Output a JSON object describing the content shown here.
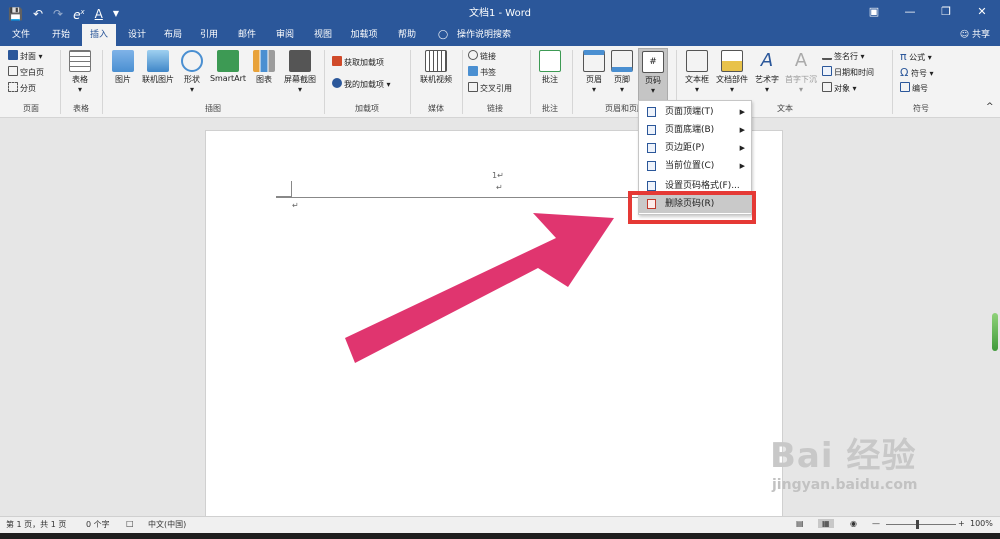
{
  "title_bar": {
    "document_title": "文档1 - Word",
    "qat_icons": [
      "save-icon",
      "undo-icon",
      "redo-icon",
      "equation-icon",
      "font-color-icon",
      "customize-qat-icon"
    ],
    "window_buttons": [
      "ribbon-display-icon",
      "minimize-icon",
      "restore-icon",
      "close-icon"
    ]
  },
  "tabs": [
    "文件",
    "开始",
    "插入",
    "设计",
    "布局",
    "引用",
    "邮件",
    "审阅",
    "视图",
    "加载项",
    "帮助"
  ],
  "active_tab": "插入",
  "tell_me": "操作说明搜索",
  "share": "共享",
  "ribbon": {
    "pages": {
      "cover": "封面",
      "blank": "空白页",
      "break": "分页",
      "label": "页面"
    },
    "tables": {
      "table": "表格",
      "label": "表格"
    },
    "illustrations": {
      "picture": "图片",
      "online_picture": "联机图片",
      "shapes": "形状",
      "smartart": "SmartArt",
      "chart": "图表",
      "screenshot": "屏幕截图",
      "label": "插图"
    },
    "addins": {
      "get": "获取加载项",
      "mine": "我的加载项",
      "label": "加载项"
    },
    "media": {
      "online_video": "联机视频",
      "label": "媒体"
    },
    "links": {
      "link": "链接",
      "bookmark": "书签",
      "cross_ref": "交叉引用",
      "label": "链接"
    },
    "comments": {
      "comment": "批注",
      "label": "批注"
    },
    "header_footer": {
      "header": "页眉",
      "footer": "页脚",
      "page_number": "页码",
      "label": "页眉和页脚"
    },
    "text": {
      "textbox": "文本框",
      "quick_parts": "文档部件",
      "wordart": "艺术字",
      "dropcap": "首字下沉",
      "signature": "签名行",
      "datetime": "日期和时间",
      "object": "对象",
      "label": "文本"
    },
    "symbols": {
      "equation": "公式",
      "symbol": "符号",
      "number": "编号",
      "label": "符号"
    }
  },
  "page_number_menu": [
    {
      "label": "页面顶端(T)",
      "submenu": true
    },
    {
      "label": "页面底端(B)",
      "submenu": true
    },
    {
      "label": "页边距(P)",
      "submenu": true
    },
    {
      "label": "当前位置(C)",
      "submenu": true
    },
    {
      "label": "设置页码格式(F)...",
      "submenu": false
    },
    {
      "label": "删除页码(R)",
      "submenu": false
    }
  ],
  "document": {
    "header_page_number": "1↵",
    "para_mark": "↵"
  },
  "status_bar": {
    "pages": "第 1 页，共 1 页",
    "words": "0 个字",
    "language": "中文(中国)",
    "zoom": "100%"
  },
  "watermark": {
    "brand": "Bai 经验",
    "url": "jingyan.baidu.com"
  },
  "colors": {
    "word_blue": "#2b579a",
    "highlight_red": "#e53935",
    "arrow_pink": "#e0356f"
  }
}
